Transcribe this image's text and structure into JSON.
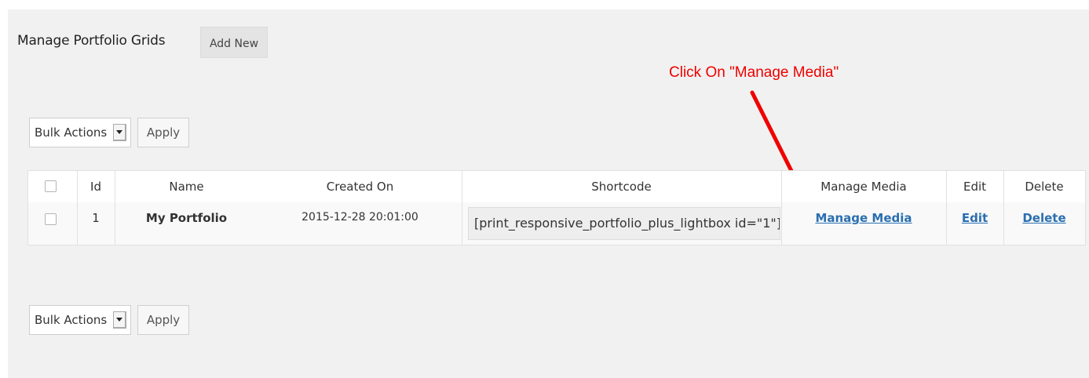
{
  "header": {
    "title": "Manage Portfolio Grids",
    "add_new_label": "Add New"
  },
  "bulk_top": {
    "select_label": "Bulk Actions",
    "apply_label": "Apply"
  },
  "bulk_bottom": {
    "select_label": "Bulk Actions",
    "apply_label": "Apply"
  },
  "annotation": {
    "text": "Click On \"Manage Media\"",
    "color": "#f00000"
  },
  "table": {
    "columns": [
      "Id",
      "Name",
      "Created On",
      "Shortcode",
      "Manage Media",
      "Edit",
      "Delete"
    ],
    "rows": [
      {
        "id": "1",
        "name": "My Portfolio",
        "created_on": "2015-12-28 20:01:00",
        "shortcode": "[print_responsive_portfolio_plus_lightbox id=\"1\"]",
        "manage_media": "Manage Media",
        "edit": "Edit",
        "delete": "Delete"
      }
    ]
  },
  "colors": {
    "panel_bg": "#f1f1f1",
    "link": "#2a6fb0",
    "accent": "#f00000"
  }
}
